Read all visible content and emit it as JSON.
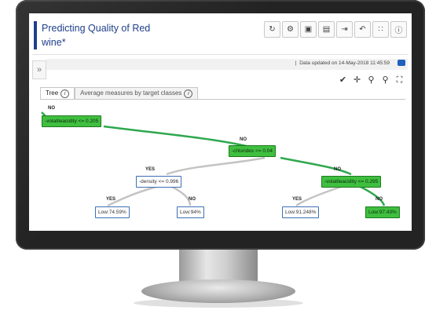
{
  "window": {
    "title": "Predicting Quality of Red wine*"
  },
  "toolbar": {
    "icons": [
      "refresh-icon",
      "settings-icon",
      "save-icon",
      "save-as-icon",
      "export-icon",
      "undo-icon",
      "layout-icon",
      "info-icon"
    ]
  },
  "status": {
    "separator": "|",
    "text": "Data updated on 14-May-2018 11:45:59"
  },
  "tabs": [
    {
      "label": "Tree"
    },
    {
      "label": "Average measures by target classes"
    }
  ],
  "tree": {
    "root": {
      "label": "-volatileacidity <= 0.205",
      "edge_label": "NO"
    },
    "n_chlorides": {
      "label": "-chlorides <= 0.04",
      "edge_label": "NO"
    },
    "n_density": {
      "label": "-density <= 0.996",
      "edge_label": "YES"
    },
    "n_volatile2": {
      "label": "-volatileacidity <= 0.295",
      "edge_label": "NO"
    },
    "leaf1": {
      "label": "Low:74.59%",
      "edge_label": "YES"
    },
    "leaf2": {
      "label": "Low:94%",
      "edge_label": "NO"
    },
    "leaf3": {
      "label": "Low:91.248%",
      "edge_label": "YES"
    },
    "leaf4": {
      "label": "Low:97.43%",
      "edge_label": "NO"
    }
  },
  "colors": {
    "highlight": "#3fbf3f",
    "path": "#2fa84f",
    "edge": "#c4c4c4",
    "title": "#1f3f8a"
  }
}
